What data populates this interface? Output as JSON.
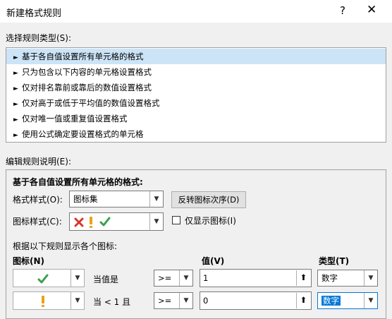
{
  "dialog": {
    "title": "新建格式规则",
    "help": "?",
    "close": "✕"
  },
  "rule_type": {
    "label": "选择规则类型(S):",
    "items": [
      "基于各自值设置所有单元格的格式",
      "只为包含以下内容的单元格设置格式",
      "仅对排名靠前或靠后的数值设置格式",
      "仅对高于或低于平均值的数值设置格式",
      "仅对唯一值或重复值设置格式",
      "使用公式确定要设置格式的单元格"
    ],
    "selected_index": 0
  },
  "edit": {
    "label": "编辑规则说明(E):",
    "heading": "基于各自值设置所有单元格的格式:",
    "format_style_label": "格式样式(O):",
    "format_style_value": "图标集",
    "reverse_button": "反转图标次序(D)",
    "icon_style_label": "图标样式(C):",
    "show_icon_only_label": "仅显示图标(I)",
    "show_icon_only_checked": false,
    "rules_caption": "根据以下规则显示各个图标:",
    "col_icon": "图标(N)",
    "col_value": "值(V)",
    "col_type": "类型(T)",
    "rows": [
      {
        "icon": "check-icon",
        "condition": "当值是",
        "op": ">=",
        "value": "1",
        "type": "数字",
        "type_selected": false
      },
      {
        "icon": "exclamation-icon",
        "condition": "当 < 1 且",
        "op": ">=",
        "value": "0",
        "type": "数字",
        "type_selected": true
      }
    ]
  },
  "colors": {
    "check": "#3aa04a",
    "exclamation": "#e8a317",
    "cross": "#d9342b",
    "selection": "#cce4f7"
  }
}
